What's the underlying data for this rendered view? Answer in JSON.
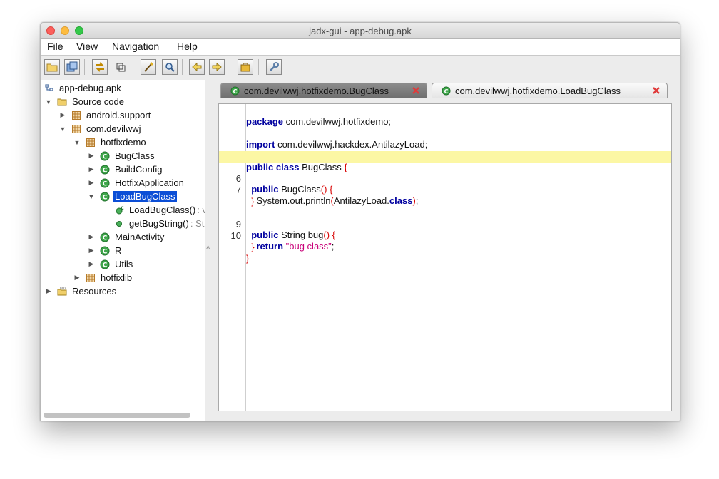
{
  "window": {
    "title": "jadx-gui - app-debug.apk"
  },
  "menu": [
    "File",
    "View",
    "Navigation",
    "Help"
  ],
  "toolbar": {
    "buttons": [
      {
        "name": "open-file-icon"
      },
      {
        "name": "save-all-icon"
      },
      {
        "name": "sync-tree-icon"
      },
      {
        "name": "flatten-packages-icon"
      },
      {
        "name": "text-search-icon"
      },
      {
        "name": "class-search-icon"
      },
      {
        "name": "back-icon"
      },
      {
        "name": "forward-icon"
      },
      {
        "name": "log-viewer-icon"
      },
      {
        "name": "preferences-icon"
      }
    ]
  },
  "tree": {
    "root": "app-debug.apk",
    "source_code": "Source code",
    "pkg_android_support": "android.support",
    "pkg_com_devilwwj": "com.devilwwj",
    "pkg_hotfixdemo": "hotfixdemo",
    "cls_bugclass": "BugClass",
    "cls_buildconfig": "BuildConfig",
    "cls_hotfixapplication": "HotfixApplication",
    "cls_loadbugclass": "LoadBugClass",
    "method_ctor": "LoadBugClass()",
    "method_ctor_suffix": " : v",
    "method_getbugstring": "getBugString()",
    "method_getbugstring_suffix": " : Str",
    "cls_mainactivity": "MainActivity",
    "cls_r": "R",
    "cls_utils": "Utils",
    "pkg_hotfixlib": "hotfixlib",
    "resources": "Resources"
  },
  "tabs": {
    "active": "com.devilwwj.hotfixdemo.BugClass",
    "inactive": "com.devilwwj.hotfixdemo.LoadBugClass"
  },
  "code": {
    "l1": {
      "kw": "package",
      "rest": " com.devilwwj.hotfixdemo;"
    },
    "l2": {
      "kw": "import",
      "rest": " com.devilwwj.hackdex.AntilazyLoad;"
    },
    "l3": {
      "kw1": "public",
      "kw2": "class",
      "name": " BugClass ",
      "brace": "{"
    },
    "l4": {
      "num": "6",
      "kw": "public",
      "name": " BugClass",
      "paren": "()",
      "brace": " {"
    },
    "l5": {
      "num": "7",
      "pre": "System.out.println",
      "po": "(",
      "mid": "AntilazyLoad.",
      "kw": "class",
      "pc": ")",
      "end": ";"
    },
    "l6": {
      "brace": "}"
    },
    "l7": {
      "num": "9",
      "kw": "public",
      "name": " String bug",
      "paren": "()",
      "brace": " {"
    },
    "l8": {
      "num": "10",
      "kw": "return",
      "str": "\"bug class\"",
      "end": ";"
    },
    "l9": {
      "brace": "}"
    },
    "l10": {
      "brace": "}"
    }
  },
  "colors": {
    "keyword": "#00009f",
    "string": "#c80078",
    "brace": "#d80000",
    "highlight_line": "#fcf7a4",
    "selection": "#0b4ed6",
    "class_icon": "#2f9e3c",
    "package_icon": "#c4822b"
  }
}
